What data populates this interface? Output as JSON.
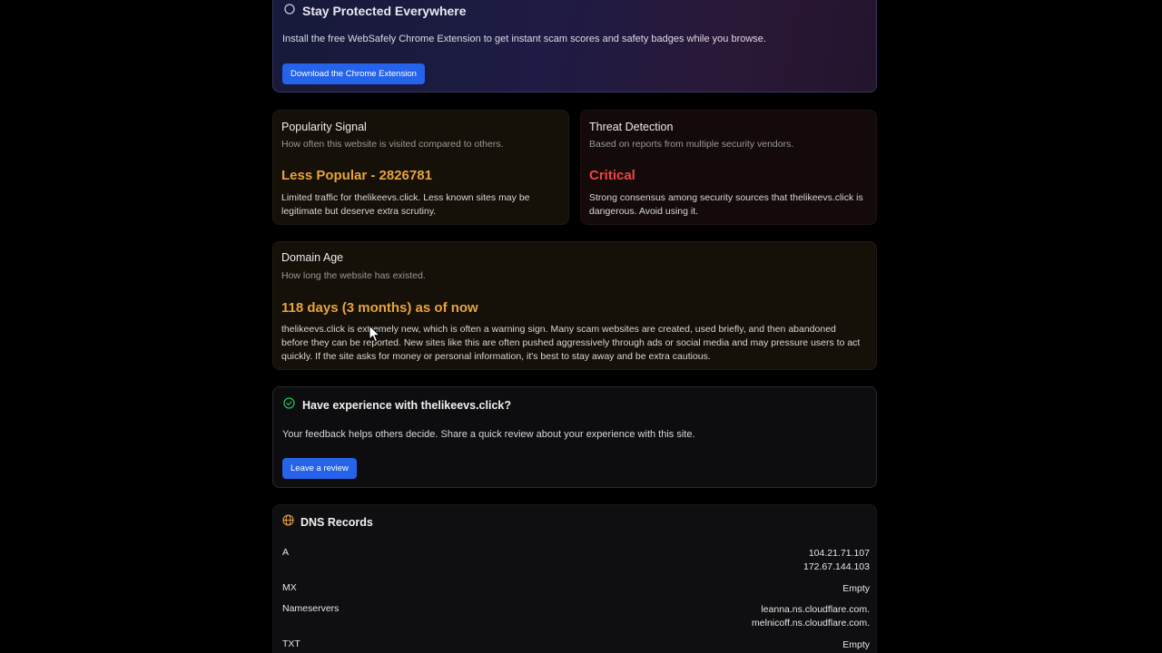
{
  "promo": {
    "title": "Stay Protected Everywhere",
    "description": "Install the free WebSafely Chrome Extension to get instant scam scores and safety badges while you browse.",
    "button_label": "Download the Chrome Extension"
  },
  "popularity": {
    "heading": "Popularity Signal",
    "subheading": "How often this website is visited compared to others.",
    "value": "Less Popular - 2826781",
    "body": "Limited traffic for thelikeevs.click. Less known sites may be legitimate but deserve extra scrutiny."
  },
  "threat": {
    "heading": "Threat Detection",
    "subheading": "Based on reports from multiple security vendors.",
    "value": "Critical",
    "body": "Strong consensus among security sources that thelikeevs.click is dangerous. Avoid using it."
  },
  "domain_age": {
    "heading": "Domain Age",
    "subheading": "How long the website has existed.",
    "value": "118 days (3 months) as of now",
    "body": "thelikeevs.click is extremely new, which is often a warning sign. Many scam websites are created, used briefly, and then abandoned before they can be reported. New sites like this are often pushed aggressively through ads or social media and may pressure users to act quickly. If the site asks for money or personal information, it's best to stay away and be extra cautious."
  },
  "review": {
    "title": "Have experience with thelikeevs.click?",
    "description": "Your feedback helps others decide. Share a quick review about your experience with this site.",
    "button_label": "Leave a review"
  },
  "dns": {
    "title": "DNS Records",
    "records": [
      {
        "type": "A",
        "value_1": "104.21.71.107",
        "value_2": "172.67.144.103"
      },
      {
        "type": "MX",
        "value_1": "Empty",
        "value_2": ""
      },
      {
        "type": "Nameservers",
        "value_1": "leanna.ns.cloudflare.com.",
        "value_2": "melnicoff.ns.cloudflare.com."
      },
      {
        "type": "TXT",
        "value_1": "Empty",
        "value_2": ""
      }
    ]
  },
  "colors": {
    "accent_button": "#2563eb",
    "warning_orange": "#e8a33d",
    "critical_red": "#ef4444",
    "success_green": "#22c55e"
  }
}
